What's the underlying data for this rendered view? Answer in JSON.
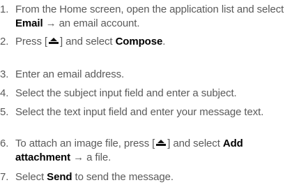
{
  "steps": [
    {
      "num": "1.",
      "parts": [
        {
          "text": "From the Home screen, open the application list and select "
        },
        {
          "bold": "Email"
        },
        {
          "text": " → an email account."
        }
      ]
    },
    {
      "num": "2.",
      "parts": [
        {
          "text": "Press ["
        },
        {
          "icon": "menu-key-icon"
        },
        {
          "text": "] and select "
        },
        {
          "bold": "Compose"
        },
        {
          "text": "."
        }
      ]
    },
    {
      "num": "3.",
      "parts": [
        {
          "text": "Enter an email address."
        }
      ]
    },
    {
      "num": "4.",
      "parts": [
        {
          "text": "Select the subject input field and enter a subject."
        }
      ]
    },
    {
      "num": "5.",
      "parts": [
        {
          "text": "Select the text input field and enter your message text."
        }
      ]
    },
    {
      "num": "6.",
      "parts": [
        {
          "text": "To attach an image file, press ["
        },
        {
          "icon": "menu-key-icon"
        },
        {
          "text": "] and select "
        },
        {
          "bold": "Add attachment"
        },
        {
          "text": " → a file."
        }
      ]
    },
    {
      "num": "7.",
      "parts": [
        {
          "text": "Select "
        },
        {
          "bold": "Send"
        },
        {
          "text": " to send the message."
        }
      ]
    }
  ]
}
